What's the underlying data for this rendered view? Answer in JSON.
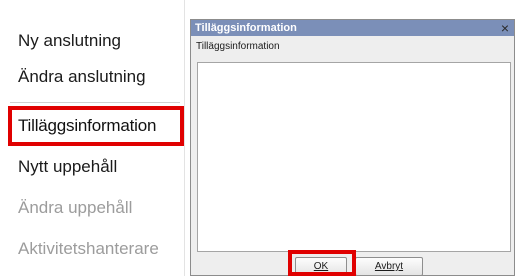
{
  "menu": {
    "items": [
      {
        "label": "Ny anslutning",
        "state": "enabled"
      },
      {
        "label": "Ändra anslutning",
        "state": "enabled"
      },
      {
        "label": "Tilläggsinformation",
        "state": "highlighted"
      },
      {
        "label": "Nytt uppehåll",
        "state": "enabled"
      },
      {
        "label": "Ändra uppehåll",
        "state": "disabled"
      },
      {
        "label": "Aktivitetshanterare",
        "state": "disabled"
      }
    ]
  },
  "dialog": {
    "title": "Tilläggsinformation",
    "close_icon": "close-icon",
    "field_label": "Tilläggsinformation",
    "text_value": "",
    "ok_label": "OK",
    "cancel_label": "Avbryt"
  },
  "colors": {
    "title_bar": "#7b8fb8",
    "highlight_box": "#e00000",
    "disabled_text": "#9c9c9c"
  }
}
